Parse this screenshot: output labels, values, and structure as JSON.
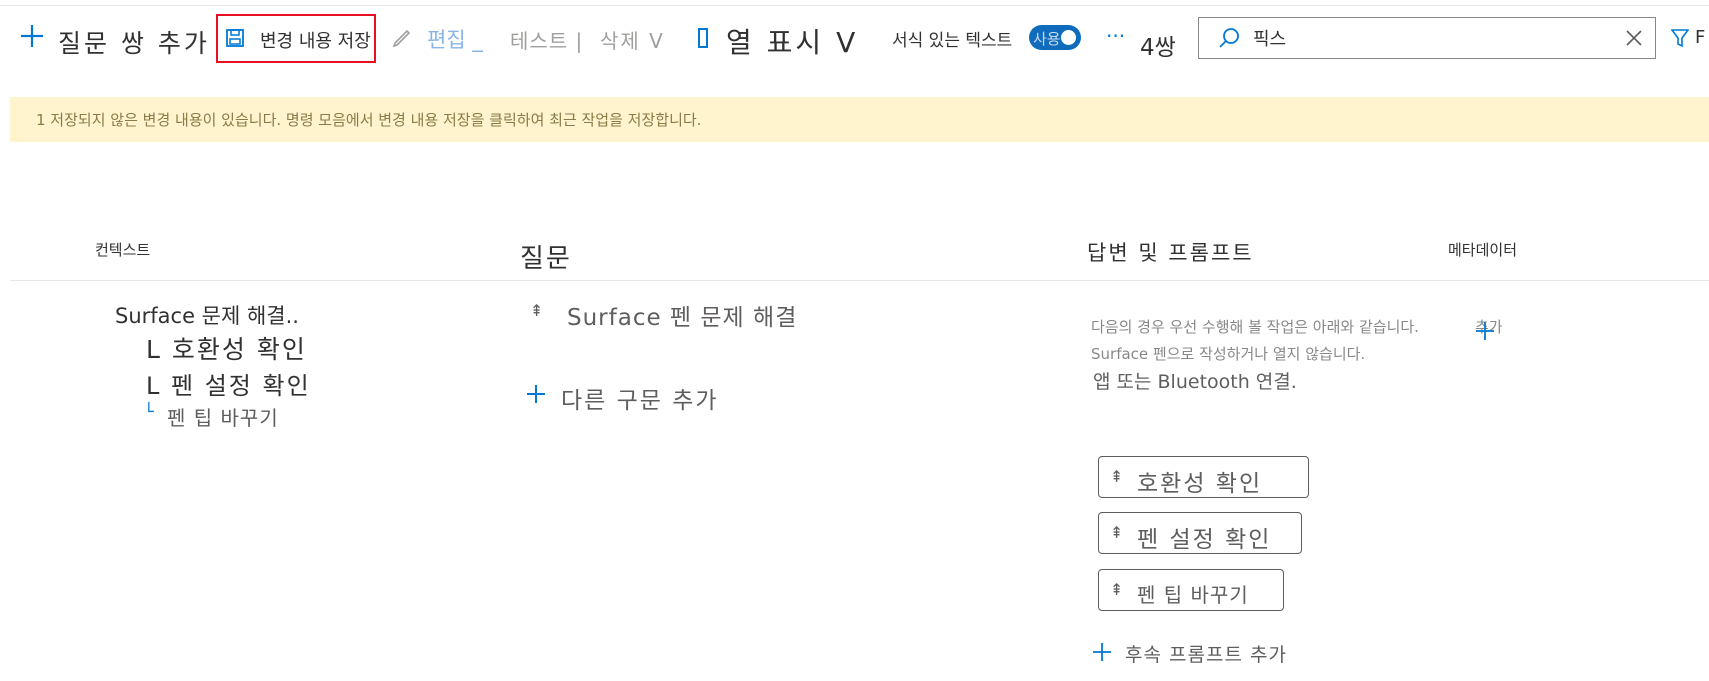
{
  "toolbar": {
    "add_pair_label": "질문 쌍 추가",
    "save_label": "변경 내용 저장",
    "edit_label": "편집 _",
    "test_label": "테스트 |",
    "delete_label": "삭제 V",
    "view_columns_label": "열 표시 V",
    "rich_text_label": "서식 있는 텍스트",
    "toggle_label": "사용",
    "more_label": "···",
    "pair_count": "4쌍",
    "search_value": "픽스",
    "filter_label": "F"
  },
  "banner": {
    "text": "1 저장되지 않은 변경 내용이 있습니다. 명령 모음에서 변경 내용 저장을 클릭하여 최근 작업을 저장합니다."
  },
  "columns": {
    "context": "컨텍스트",
    "question": "질문",
    "answer": "답변 및 프롬프트",
    "metadata": "메타데이터"
  },
  "context_tree": {
    "root": "Surface 문제 해결..",
    "child1": "L 호환성 확인",
    "child2": "L 펜 설정 확인",
    "child3": "펜 팁 바꾸기"
  },
  "question": {
    "text": "Surface 펜 문제 해결",
    "add_alt": "다른 구문 추가"
  },
  "answer": {
    "line1": "다음의 경우 우선 수행해 볼 작업은 아래와 같습니다.",
    "line1_suffix": "추가",
    "line2": "Surface 펜으로 작성하거나 열지 않습니다.",
    "line3": "앱 또는 Bluetooth 연결.",
    "prompts": [
      "호환성 확인",
      "펜 설정 확인",
      "펜 팁 바꾸기"
    ],
    "add_prompt": "후속 프롬프트 추가"
  },
  "colors": {
    "accent": "#0078d4",
    "banner_bg": "#fff4ce",
    "highlight": "#e81123"
  }
}
